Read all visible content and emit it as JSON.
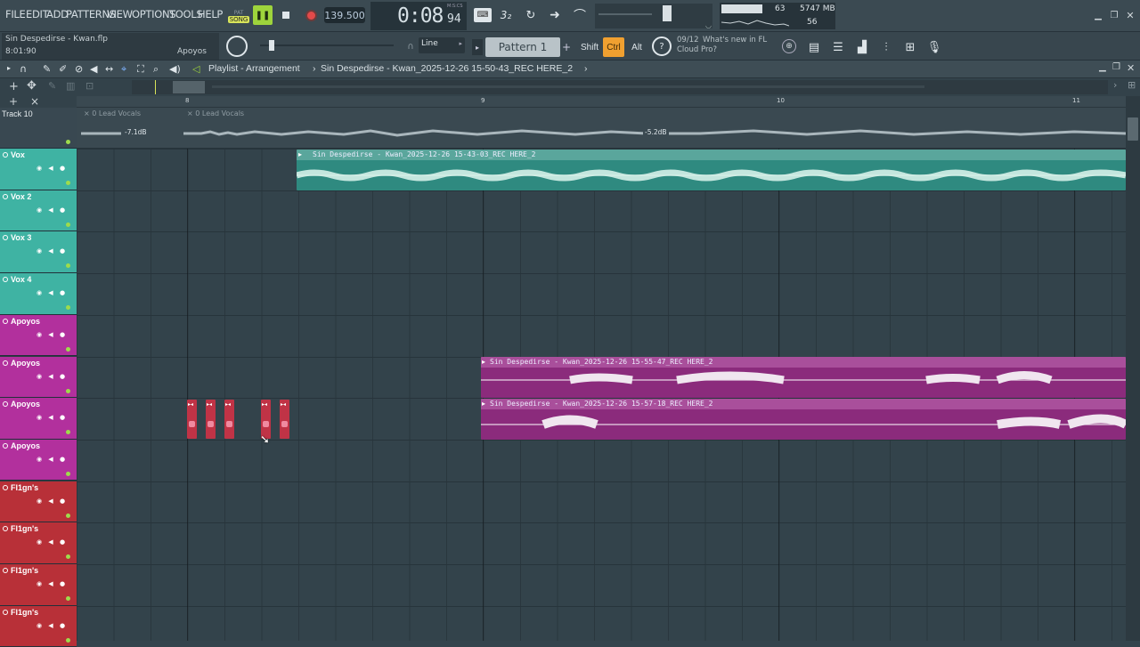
{
  "menu": [
    "FILE",
    "EDIT",
    "ADD",
    "PATTERNS",
    "VIEW",
    "OPTIONS",
    "TOOLS",
    "HELP"
  ],
  "transport": {
    "pat_label": "PAT",
    "song_label": "SONG",
    "tempo": "139.500",
    "time_main": "0:08",
    "time_sub": "94",
    "time_unit": "M:S:CS"
  },
  "monitor": {
    "cpu": "63",
    "memory": "5747 MB",
    "poly": "56"
  },
  "project": {
    "filename": "Sin Despedirse - Kwan.flp",
    "position": "8:01:90",
    "channel": "Apoyos"
  },
  "toolbar2": {
    "snap": "Line",
    "pattern": "Pattern 1",
    "shift": "Shift",
    "ctrl": "Ctrl",
    "alt": "Alt",
    "news_date": "09/12",
    "news_text": "What's new in FL",
    "news_text2": "Cloud Pro?"
  },
  "playlist": {
    "title": "Playlist - Arrangement",
    "breadcrumb": "Sin Despedirse - Kwan_2025-12-26 15-50-43_REC HERE_2"
  },
  "ruler": {
    "bars": [
      "8",
      "9",
      "10",
      "11"
    ]
  },
  "automation": {
    "track": "Track 10",
    "lane1": "0 Lead Vocals",
    "lane2": "0 Lead Vocals",
    "db1": "-7.1dB",
    "db2": "-5.2dB"
  },
  "tracks": [
    {
      "name": "Vox",
      "color": "#3fb3a3"
    },
    {
      "name": "Vox 2",
      "color": "#3fb3a3"
    },
    {
      "name": "Vox 3",
      "color": "#3fb3a3"
    },
    {
      "name": "Vox 4",
      "color": "#3fb3a3"
    },
    {
      "name": "Apoyos",
      "color": "#b2309d"
    },
    {
      "name": "Apoyos",
      "color": "#b2309d"
    },
    {
      "name": "Apoyos",
      "color": "#b2309d"
    },
    {
      "name": "Apoyos",
      "color": "#b2309d"
    },
    {
      "name": "Fl1gn's",
      "color": "#b83038"
    },
    {
      "name": "Fl1gn's",
      "color": "#b83038"
    },
    {
      "name": "Fl1gn's",
      "color": "#b83038"
    },
    {
      "name": "Fl1gn's",
      "color": "#b83038"
    }
  ],
  "clips": {
    "vox": "Sin Despedirse - Kwan_2025-12-26 15-43-03_REC HERE_2",
    "apoyos1": "Sin Despedirse - Kwan_2025-12-26 15-55-47_REC HERE_2",
    "apoyos2": "Sin Despedirse - Kwan_2025-12-26 15-57-18_REC HERE_2"
  },
  "colors": {
    "teal": "#3fb3a3",
    "magenta": "#b2309d",
    "red": "#b83038",
    "accent_orange": "#f0a030"
  }
}
